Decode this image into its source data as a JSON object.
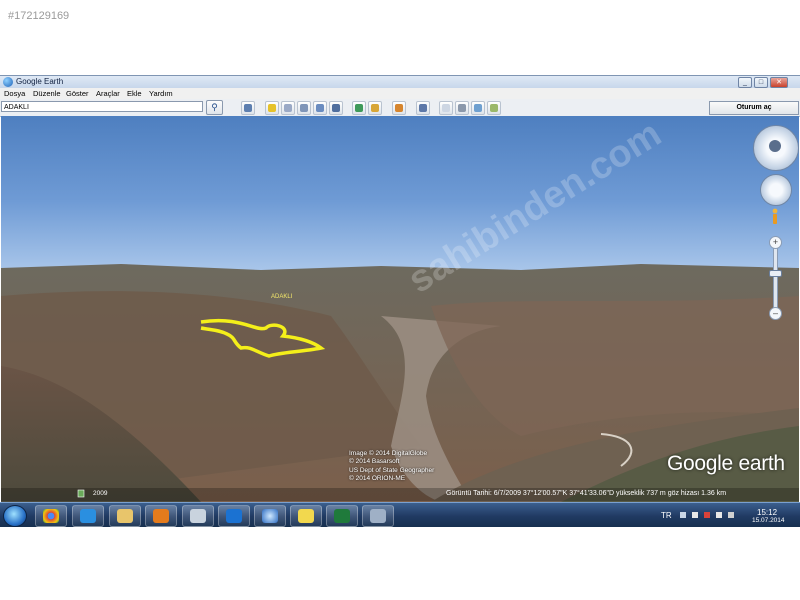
{
  "listing_id": "#172129169",
  "window": {
    "title": "Google Earth",
    "minimize": "_",
    "maximize": "□",
    "close": "✕"
  },
  "menu": [
    "Dosya",
    "Düzenle",
    "Göster",
    "Araçlar",
    "Ekle",
    "Yardım"
  ],
  "search": {
    "value": "ADAKLI",
    "button_icon": "search-icon"
  },
  "toolbar_icons": [
    "sidebar-icon",
    "placemark-icon",
    "polygon-icon",
    "path-icon",
    "image-overlay-icon",
    "tour-icon",
    "historical-imagery-icon",
    "sunlight-icon",
    "planets-icon",
    "ruler-icon",
    "email-icon",
    "print-icon",
    "view-in-maps-icon"
  ],
  "login_label": "Oturum aç",
  "map": {
    "place_label": "ADAKLI",
    "watermark": "sahibinden.com",
    "credits": [
      "Image © 2014 DigitalGlobe",
      "© 2014 Basarsoft",
      "US Dept of State Geographer",
      "© 2014 ORION-ME"
    ],
    "brand": "Google earth",
    "imagery_year": "2009",
    "status": "Görüntü Tarihi: 6/7/2009     37°12'00.57\"K     37°41'33.06\"D  yükseklik   737 m      göz hizası    1.36 km",
    "path_color": "#f4ef1a"
  },
  "taskbar": {
    "apps": [
      "explorer-icon",
      "chrome-icon",
      "internet-explorer-icon",
      "folder-icon",
      "media-player-icon",
      "calculator-icon",
      "teamviewer-icon",
      "google-earth-icon",
      "paint-icon",
      "excel-icon",
      "tools-icon"
    ],
    "language": "TR",
    "time": "15:12",
    "date": "15.07.2014"
  }
}
